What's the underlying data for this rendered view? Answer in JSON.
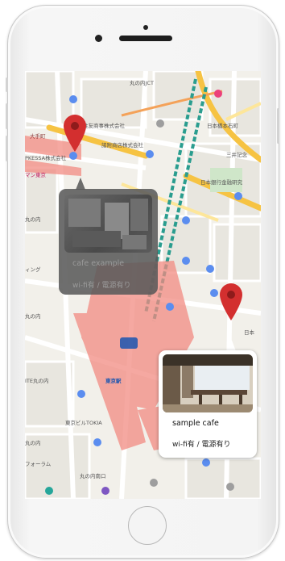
{
  "map": {
    "labels": [
      {
        "text": "丸の内JCT",
        "color": "#555"
      },
      {
        "text": "住友商事株式会社",
        "color": "#555"
      },
      {
        "text": "諸附商店株式会社",
        "color": "#555"
      },
      {
        "text": "大手町",
        "color": "#8a3a3a"
      },
      {
        "text": "PKESSA株式会社",
        "color": "#555"
      },
      {
        "text": "マン東京",
        "color": "#c2185b"
      },
      {
        "text": "日本橋本石町",
        "color": "#555"
      },
      {
        "text": "日本銀行金融研究",
        "color": "#555"
      },
      {
        "text": "三井記念",
        "color": "#555"
      },
      {
        "text": "丸の内",
        "color": "#555"
      },
      {
        "text": "ィング",
        "color": "#555"
      },
      {
        "text": "丸の内",
        "color": "#555"
      },
      {
        "text": "ITE丸の内",
        "color": "#555"
      },
      {
        "text": "東京駅",
        "color": "#1a55b0"
      },
      {
        "text": "東京ビルTOKIA",
        "color": "#555"
      },
      {
        "text": "丸の内",
        "color": "#555"
      },
      {
        "text": "フォーラム",
        "color": "#555"
      },
      {
        "text": "丸の内南口",
        "color": "#555"
      },
      {
        "text": "日本",
        "color": "#555"
      }
    ]
  },
  "markers": [
    {
      "name": "cafe-example",
      "color": "#d32f2f"
    },
    {
      "name": "sample-cafe",
      "color": "#d32f2f"
    }
  ],
  "cards": {
    "cafe_example": {
      "title": "cafe example",
      "subtitle": "wi-fi有 / 電源有り"
    },
    "sample_cafe": {
      "title": "sample cafe",
      "subtitle": "wi-fi有 / 電源有り"
    }
  },
  "colors": {
    "marker": "#d32f2f",
    "rail_overlay": "#f28b82",
    "highway": "#f9c74f",
    "rail_teal": "#2a9d8f"
  }
}
